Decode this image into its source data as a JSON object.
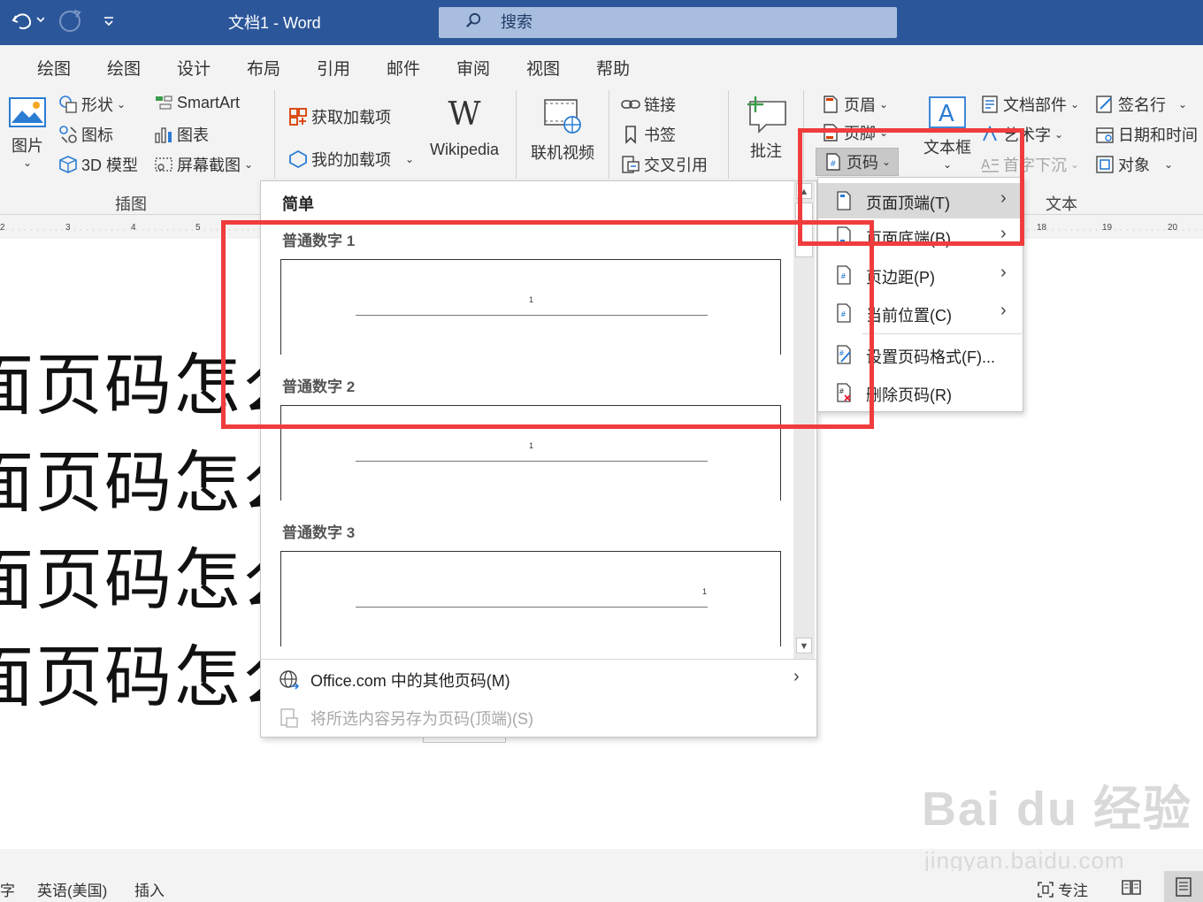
{
  "titlebar": {
    "doc_title": "文档1  -  Word",
    "search_placeholder": "搜索"
  },
  "tabs": [
    "绘图",
    "绘图",
    "设计",
    "布局",
    "引用",
    "邮件",
    "审阅",
    "视图",
    "帮助"
  ],
  "ribbon": {
    "picture": "图片",
    "shapes": "形状",
    "icons": "图标",
    "models3d": "3D 模型",
    "smartart": "SmartArt",
    "chart": "图表",
    "screenshot": "屏幕截图",
    "illustrations_group": "插图",
    "get_addins": "获取加载项",
    "my_addins": "我的加载项",
    "wikipedia": "Wikipedia",
    "online_video": "联机视频",
    "link": "链接",
    "bookmark": "书签",
    "crossref": "交叉引用",
    "comment": "批注",
    "header": "页眉",
    "footer": "页脚",
    "page_number": "页码",
    "textbox": "文本框",
    "quickparts": "文档部件",
    "wordart": "艺术字",
    "dropcap": "首字下沉",
    "signature": "签名行",
    "datetime": "日期和时间",
    "object": "对象",
    "text_group": "文本"
  },
  "ruler": {
    "left_ticks": [
      "2",
      "3",
      "4",
      "5"
    ],
    "right_ticks": [
      "18",
      "19",
      "20"
    ]
  },
  "document": {
    "lines": [
      "面页码怎么",
      "面页码怎么",
      "面页码怎么",
      "面页码怎么"
    ]
  },
  "gallery": {
    "category": "简单",
    "items": [
      {
        "label": "普通数字 1",
        "num": "1"
      },
      {
        "label": "普通数字 2",
        "num": "1"
      },
      {
        "label": "普通数字 3",
        "num": "1"
      }
    ],
    "more_from_office": "Office.com 中的其他页码(M)",
    "save_selection": "将所选内容另存为页码(顶端)(S)"
  },
  "submenu": {
    "items": [
      {
        "label": "页面顶端(T)",
        "submenu": true
      },
      {
        "label": "页面底端(B)",
        "submenu": true
      },
      {
        "label": "页边距(P)",
        "submenu": true
      },
      {
        "label": "当前位置(C)",
        "submenu": true
      },
      {
        "label": "设置页码格式(F)...",
        "submenu": false
      },
      {
        "label": "删除页码(R)",
        "submenu": false
      }
    ]
  },
  "statusbar": {
    "chars": "字",
    "language": "英语(美国)",
    "mode": "插入",
    "focus": "专注"
  },
  "watermark": {
    "brand": "Bai du 经验",
    "url": "jingyan.baidu.com"
  },
  "colors": {
    "title_bar": "#2b579a",
    "annotation_red": "#f03c3c"
  }
}
